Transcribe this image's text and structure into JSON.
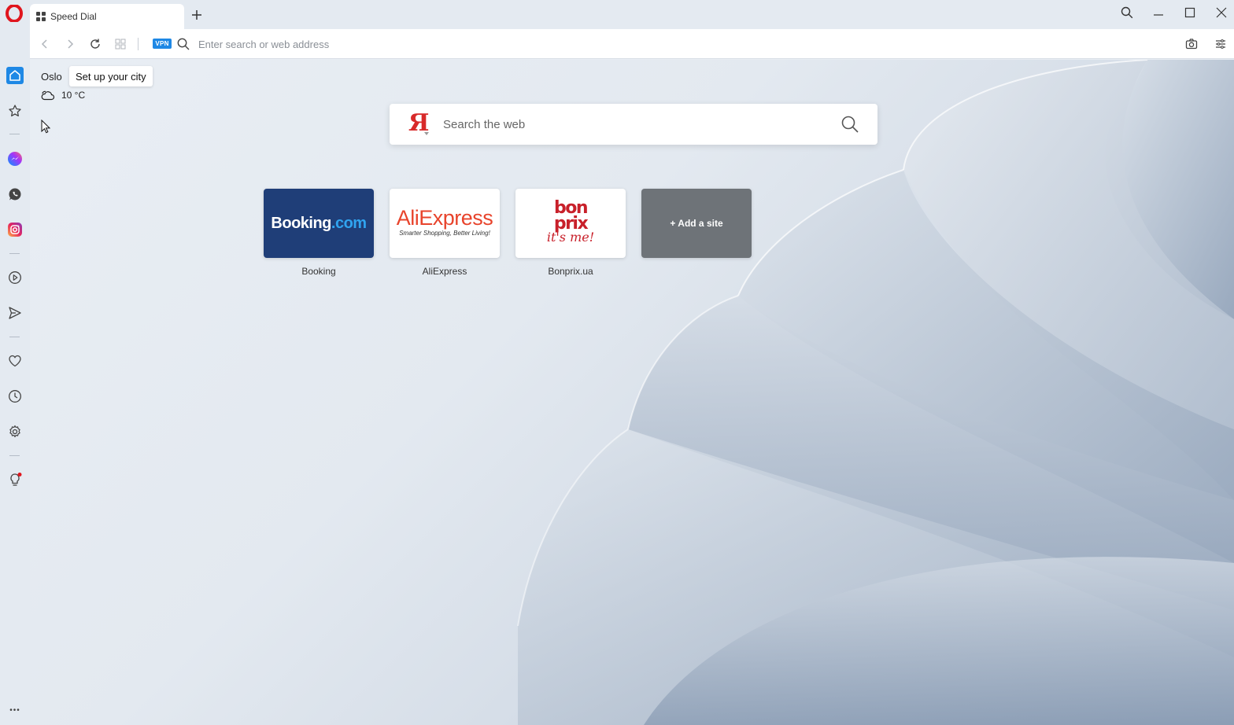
{
  "window": {
    "tab_title": "Speed Dial",
    "new_tab_symbol": "+"
  },
  "addressbar": {
    "vpn_label": "VPN",
    "placeholder": "Enter search or web address"
  },
  "weather": {
    "city": "Oslo",
    "tooltip": "Set up your city",
    "temperature": "10 °C"
  },
  "search": {
    "logo_letter": "Я",
    "placeholder": "Search the web"
  },
  "speed_dial": {
    "booking": {
      "label": "Booking",
      "logo_main": "Booking",
      "logo_suffix": ".com"
    },
    "aliexpress": {
      "label": "AliExpress",
      "logo_main": "AliExpress",
      "logo_sub": "Smarter Shopping, Better Living!"
    },
    "bonprix": {
      "label": "Bonprix.ua",
      "logo_line1": "bon",
      "logo_line2": "prix",
      "logo_line3": "it's me!"
    },
    "add_site": {
      "label": "+ Add a site"
    }
  },
  "sidebar": {
    "more_symbol": "•••"
  },
  "colors": {
    "accent": "#1e88e5",
    "opera_red": "#e0161e",
    "booking_blue": "#1f3e78",
    "aliexpress_red": "#e8442c",
    "bonprix_red": "#c8202a",
    "add_tile_gray": "#6e7378"
  },
  "icons": {
    "titlebar": [
      "opera-logo-icon",
      "search-icon",
      "minimize-icon",
      "maximize-icon",
      "close-icon"
    ],
    "addressbar": [
      "back-icon",
      "forward-icon",
      "reload-icon",
      "tabs-grid-icon",
      "search-icon",
      "camera-icon",
      "easy-setup-icon"
    ],
    "sidebar": [
      "home-icon",
      "bookmarks-icon",
      "messenger-icon",
      "whatsapp-icon",
      "instagram-icon",
      "player-icon",
      "send-icon",
      "heart-icon",
      "history-icon",
      "settings-icon",
      "tips-bulb-icon",
      "more-icon"
    ]
  }
}
